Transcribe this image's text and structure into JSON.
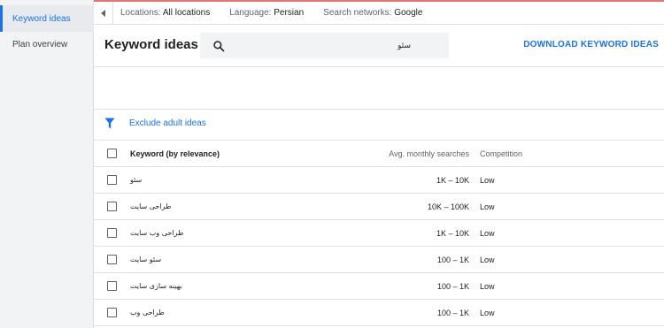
{
  "sidebar": {
    "items": [
      {
        "label": "Keyword ideas"
      },
      {
        "label": "Plan overview"
      }
    ]
  },
  "topbar": {
    "locations_key": "Locations:",
    "locations_value": "All locations",
    "language_key": "Language:",
    "language_value": "Persian",
    "networks_key": "Search networks:",
    "networks_value": "Google"
  },
  "header": {
    "title": "Keyword ideas",
    "search_value": "سئو",
    "download_label": "DOWNLOAD KEYWORD IDEAS"
  },
  "filter": {
    "label": "Exclude adult ideas"
  },
  "table": {
    "headers": {
      "keyword": "Keyword (by relevance)",
      "avg": "Avg. monthly searches",
      "competition": "Competition"
    },
    "rows": [
      {
        "keyword": "سئو",
        "avg": "1K – 10K",
        "competition": "Low"
      },
      {
        "keyword": "طراحی سایت",
        "avg": "10K – 100K",
        "competition": "Low"
      },
      {
        "keyword": "طراحی وب سایت",
        "avg": "1K – 10K",
        "competition": "Low"
      },
      {
        "keyword": "سئو سایت",
        "avg": "100 – 1K",
        "competition": "Low"
      },
      {
        "keyword": "بهینه سازی سایت",
        "avg": "100 – 1K",
        "competition": "Low"
      },
      {
        "keyword": "طراحی وب",
        "avg": "100 – 1K",
        "competition": "Low"
      }
    ]
  },
  "colors": {
    "accent": "#1a73e8",
    "top_border": "#e57373",
    "sidebar_bg": "#f1f3f4"
  }
}
